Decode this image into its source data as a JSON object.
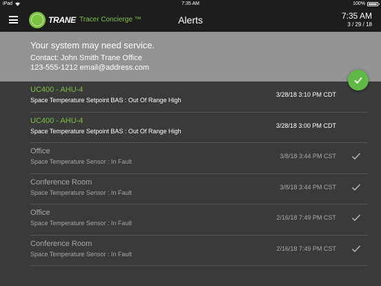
{
  "statusbar": {
    "device": "iPad",
    "time": "7:35 AM",
    "battery": "100%"
  },
  "appbar": {
    "logo_text": "TRANE",
    "product": "Tracer Concierge ™",
    "title": "Alerts",
    "clock_time": "7:35 AM",
    "clock_date": "3 / 29 / 18"
  },
  "banner": {
    "headline": "Your system may need service.",
    "contact": "Contact: John Smith Trane Office",
    "phone": "123-555-1212 email@address.com"
  },
  "colors": {
    "accent": "#7cc242",
    "ack_button": "#5fb944",
    "banner": "#939393",
    "background": "#3a3a3a"
  },
  "alerts": [
    {
      "name": "UC400 - AHU-4",
      "desc": "Space Temperature Setpoint BAS : Out Of Range High",
      "ts": "3/28/18 3:10 PM CDT",
      "acknowledged": false
    },
    {
      "name": "UC400 - AHU-4",
      "desc": "Space Temperature Setpoint BAS : Out Of Range High",
      "ts": "3/28/18 3:00 PM CDT",
      "acknowledged": false
    },
    {
      "name": "Office",
      "desc": "Space Temperature Sensor : In Fault",
      "ts": "3/8/18 3:44 PM CST",
      "acknowledged": true
    },
    {
      "name": "Conference Room",
      "desc": "Space Temperature Sensor : In Fault",
      "ts": "3/8/18 3:44 PM CST",
      "acknowledged": true
    },
    {
      "name": "Office",
      "desc": "Space Temperature Sensor : In Fault",
      "ts": "2/16/18 7:49 PM CST",
      "acknowledged": true
    },
    {
      "name": "Conference Room",
      "desc": "Space Temperature Sensor : In Fault",
      "ts": "2/16/18 7:49 PM CST",
      "acknowledged": true
    }
  ]
}
